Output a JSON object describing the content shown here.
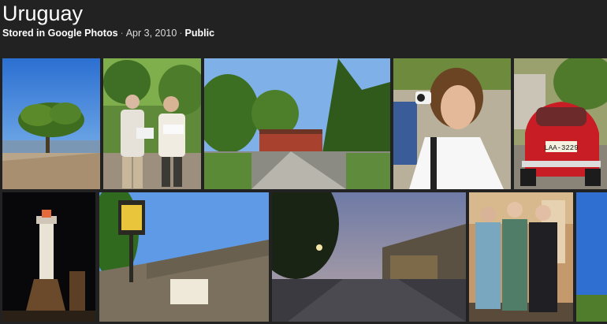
{
  "album": {
    "title": "Uruguay",
    "stored": "Stored in Google Photos",
    "date": "Apr 3, 2010",
    "visibility": "Public",
    "separator": "·"
  },
  "photos": [
    {
      "id": "tree-by-water",
      "subject": "tree by water"
    },
    {
      "id": "tourists-map",
      "subject": "tourists with map"
    },
    {
      "id": "street-trees",
      "subject": "street with trees and red house"
    },
    {
      "id": "woman-camera",
      "subject": "woman taking photo"
    },
    {
      "id": "red-car",
      "subject": "red Fiat car",
      "plate_text": "LAA-3229"
    },
    {
      "id": "lighthouse-night",
      "subject": "lighthouse at night"
    },
    {
      "id": "lamp-wall",
      "subject": "street lamp and stone wall"
    },
    {
      "id": "dusk-street",
      "subject": "cobblestone street at dusk"
    },
    {
      "id": "group-portrait",
      "subject": "three people portrait"
    },
    {
      "id": "sky-edge",
      "subject": "blue sky partial"
    }
  ]
}
